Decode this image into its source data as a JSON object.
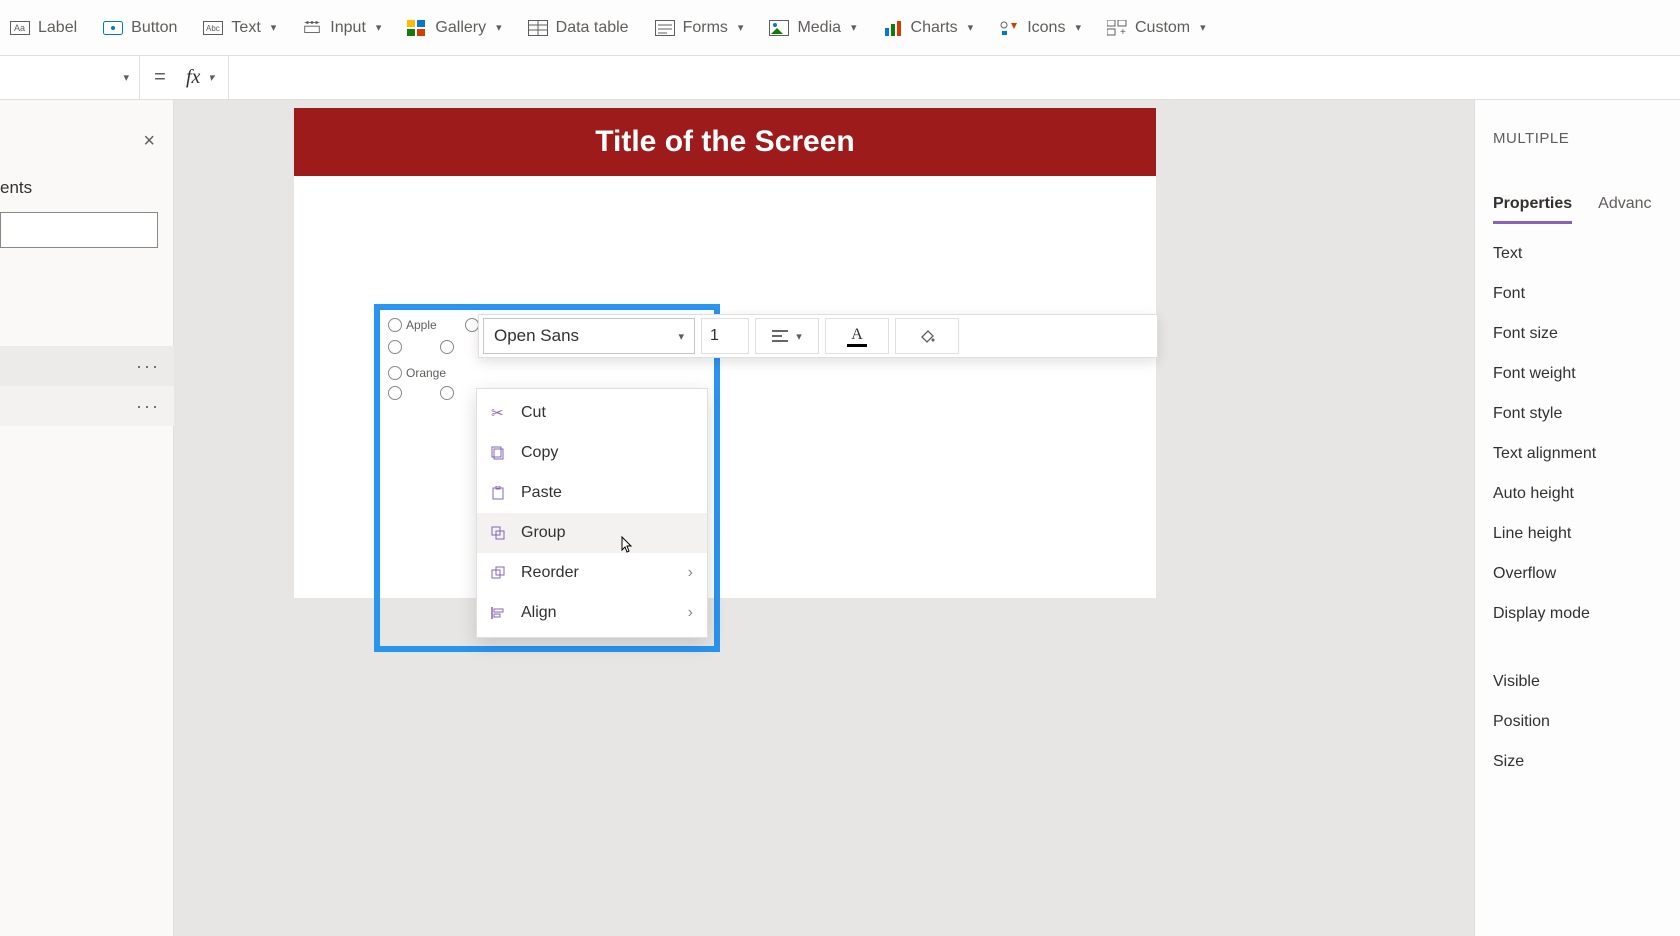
{
  "ribbon": {
    "label": "Label",
    "button": "Button",
    "text": "Text",
    "input": "Input",
    "gallery": "Gallery",
    "data_table": "Data table",
    "forms": "Forms",
    "media": "Media",
    "charts": "Charts",
    "icons": "Icons",
    "custom": "Custom"
  },
  "formula": {
    "equals": "=",
    "fx": "fx"
  },
  "left": {
    "label": "ents",
    "row1_more": "···",
    "row2_more": "···"
  },
  "canvas": {
    "title": "Title of the Screen",
    "label1": "Apple",
    "label2": "Orange",
    "font": "Open Sans"
  },
  "context": {
    "cut": "Cut",
    "copy": "Copy",
    "paste": "Paste",
    "group": "Group",
    "reorder": "Reorder",
    "align": "Align"
  },
  "right": {
    "title": "MULTIPLE",
    "tab_props": "Properties",
    "tab_adv": "Advanc",
    "rows": [
      "Text",
      "Font",
      "Font size",
      "Font weight",
      "Font style",
      "Text alignment",
      "Auto height",
      "Line height",
      "Overflow",
      "Display mode"
    ],
    "rows2": [
      "Visible",
      "Position",
      "Size"
    ]
  }
}
